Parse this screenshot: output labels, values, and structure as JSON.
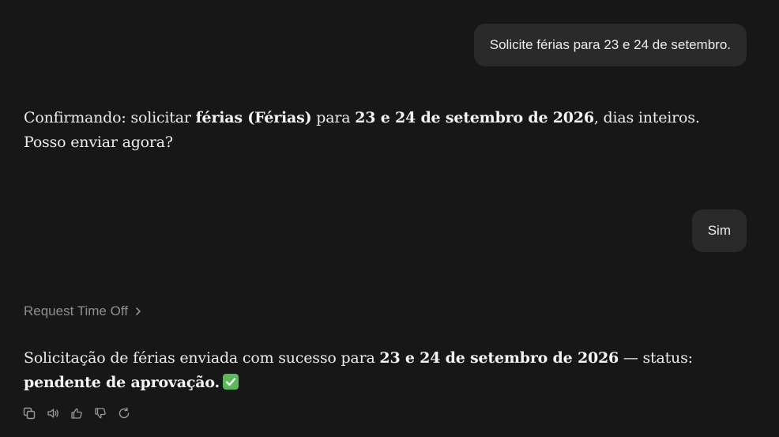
{
  "conversation": {
    "user_message_1": "Solicite férias para 23 e 24 de setembro.",
    "assistant_message_1": {
      "p1": "Confirmando: solicitar ",
      "b1": "férias (Férias)",
      "p2": " para ",
      "b2": "23 e 24 de setembro de 2026",
      "p3": ", dias inteiros. Posso enviar agora?"
    },
    "user_message_2": "Sim",
    "tool_call": {
      "label": "Request Time Off",
      "icon": "chevron-right-icon"
    },
    "assistant_message_2": {
      "p1": "Solicitação de férias enviada com sucesso para ",
      "b1": "23 e 24 de setembro de 2026",
      "p2": " — status: ",
      "b2": "pendente de aprovação.",
      "emoji": "check-mark-button-icon"
    }
  },
  "actions": [
    {
      "name": "copy",
      "icon": "copy-icon"
    },
    {
      "name": "read-aloud",
      "icon": "speaker-icon"
    },
    {
      "name": "good-response",
      "icon": "thumbs-up-icon"
    },
    {
      "name": "bad-response",
      "icon": "thumbs-down-icon"
    },
    {
      "name": "regenerate",
      "icon": "refresh-icon"
    }
  ],
  "colors": {
    "background": "#171717",
    "user_bubble": "#2a2a2a",
    "text": "#ececec",
    "muted": "#8f8f8f",
    "check_green": "#5cb85c"
  }
}
